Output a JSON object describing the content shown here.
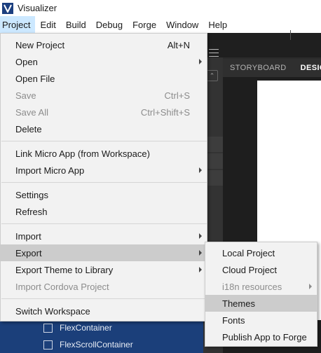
{
  "window": {
    "title": "Visualizer"
  },
  "menubar": {
    "items": [
      {
        "label": "Project"
      },
      {
        "label": "Edit"
      },
      {
        "label": "Build"
      },
      {
        "label": "Debug"
      },
      {
        "label": "Forge"
      },
      {
        "label": "Window"
      },
      {
        "label": "Help"
      }
    ]
  },
  "canvas_tabs": [
    {
      "label": "STORYBOARD"
    },
    {
      "label": "DESIG"
    }
  ],
  "project_menu": {
    "items": [
      {
        "label": "New Project",
        "shortcut": "Alt+N"
      },
      {
        "label": "Open"
      },
      {
        "label": "Open File"
      },
      {
        "label": "Save",
        "shortcut": "Ctrl+S"
      },
      {
        "label": "Save All",
        "shortcut": "Ctrl+Shift+S"
      },
      {
        "label": "Delete"
      },
      {
        "label": "Link Micro App (from Workspace)"
      },
      {
        "label": "Import Micro App"
      },
      {
        "label": "Settings"
      },
      {
        "label": "Refresh"
      },
      {
        "label": "Import"
      },
      {
        "label": "Export"
      },
      {
        "label": "Export Theme to Library"
      },
      {
        "label": "Import Cordova Project"
      },
      {
        "label": "Switch Workspace"
      }
    ]
  },
  "export_menu": {
    "items": [
      {
        "label": "Local Project"
      },
      {
        "label": "Cloud Project"
      },
      {
        "label": "i18n resources"
      },
      {
        "label": "Themes"
      },
      {
        "label": "Fonts"
      },
      {
        "label": "Publish App to Forge"
      }
    ]
  },
  "widgets": [
    {
      "label": "FlexContainer"
    },
    {
      "label": "FlexScrollContainer"
    }
  ],
  "colors": {
    "menu_background": "#f2f2f2",
    "menu_highlight": "#cccccc",
    "menubar_active": "#cce8ff",
    "disabled_text": "#8c8c8c",
    "logo_blue": "#1c3f80",
    "widgets_panel": "#1b3f7a"
  }
}
